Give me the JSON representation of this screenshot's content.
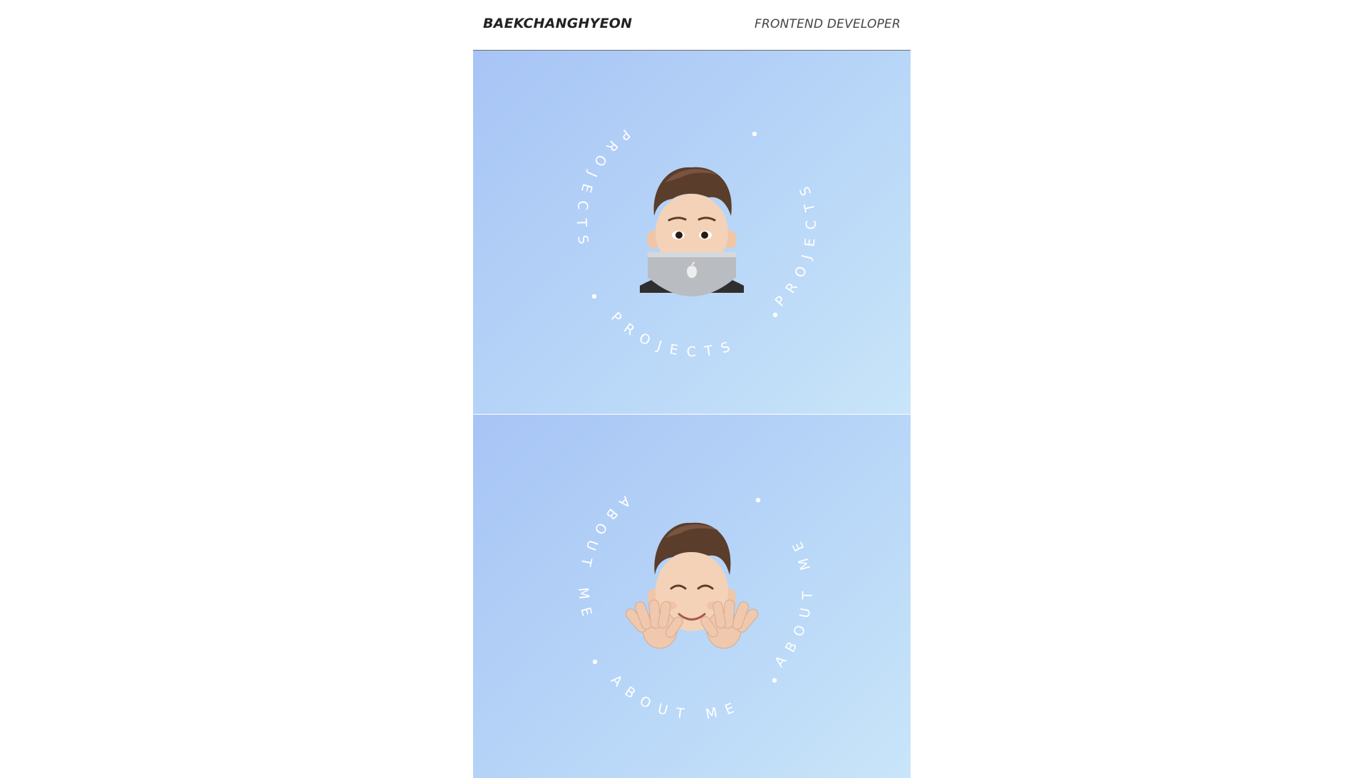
{
  "header": {
    "brand": "BAEKCHANGHYEON",
    "role": "FRONTEND DEVELOPER"
  },
  "cards": [
    {
      "ring_word": "PROJECTS",
      "avatar_icon": "memoji-laptop-icon"
    },
    {
      "ring_word": "ABOUT ME",
      "avatar_icon": "memoji-waving-hands-icon"
    }
  ],
  "colors": {
    "gradient_start": "#a7c4f6",
    "gradient_end": "#c8e5f9",
    "ring_text": "#ffffff",
    "header_rule": "#6f6f6f"
  }
}
